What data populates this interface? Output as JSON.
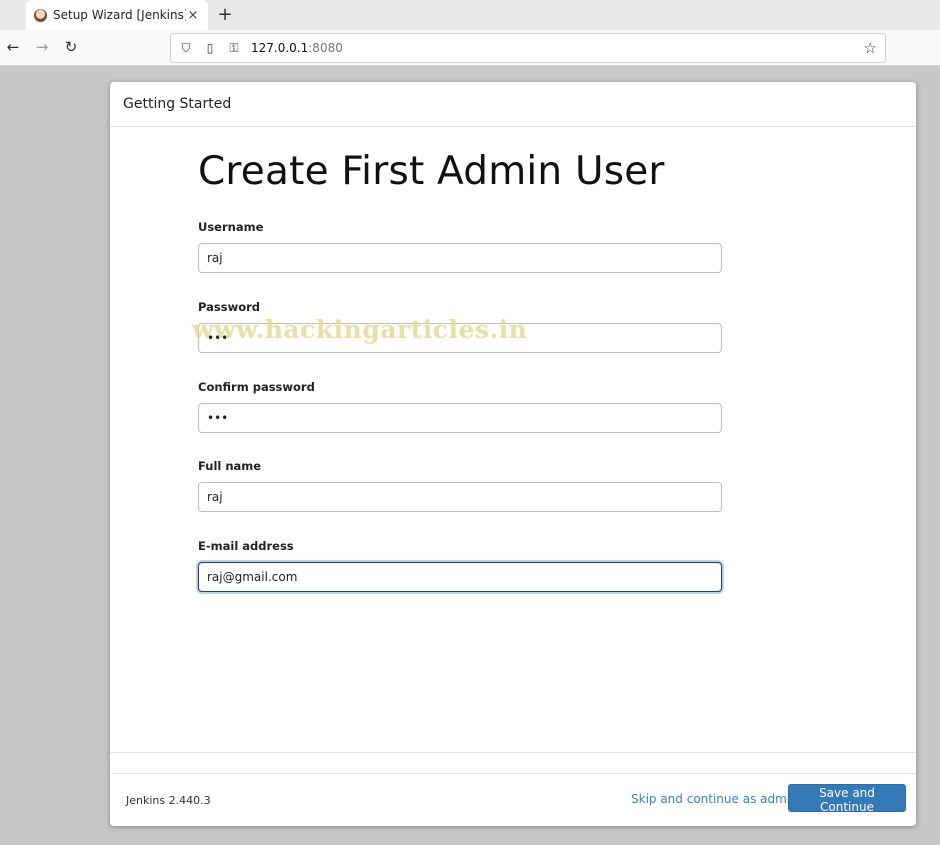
{
  "browser": {
    "tab_title": "Setup Wizard [Jenkins]",
    "tab_close": "×",
    "new_tab": "+",
    "url_host": "127.0.0.1",
    "url_port": ":8080",
    "icons": {
      "back": "←",
      "forward": "→",
      "reload": "↻",
      "shield": "⛉",
      "page": "▯",
      "key": "⚿",
      "star": "☆"
    }
  },
  "dialog": {
    "header": "Getting Started",
    "title": "Create First Admin User",
    "fields": [
      {
        "label": "Username",
        "value": "raj"
      },
      {
        "label": "Password",
        "value": "•••"
      },
      {
        "label": "Confirm password",
        "value": "•••"
      },
      {
        "label": "Full name",
        "value": "raj"
      },
      {
        "label": "E-mail address",
        "value": "raj@gmail.com"
      }
    ],
    "watermark": "www.hackingarticles.in"
  },
  "footer": {
    "version": "Jenkins 2.440.3",
    "skip_label": "Skip and continue as admin",
    "save_label": "Save and Continue"
  },
  "colors": {
    "primary_button": "#337ab7",
    "link": "#3a7fc1",
    "focus_ring": "#b9d3ea"
  }
}
